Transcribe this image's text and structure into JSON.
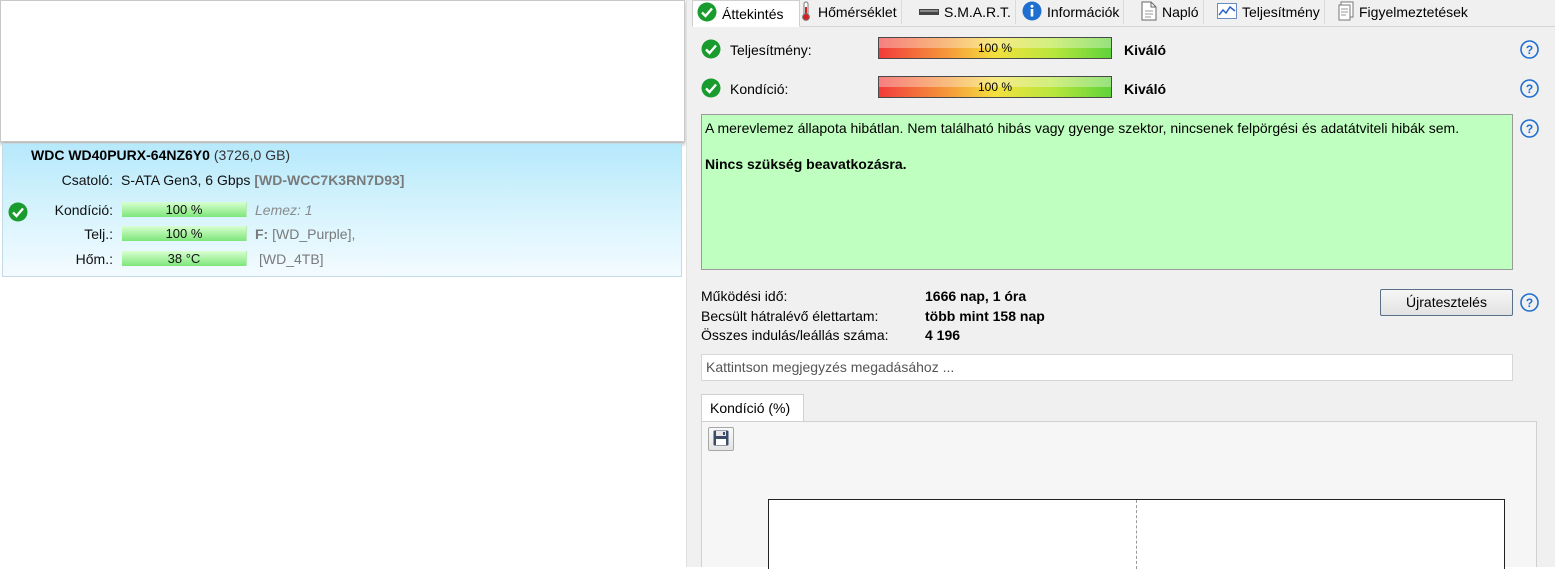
{
  "disk": {
    "title_model": "WDC WD40PURX-64NZ6Y0",
    "title_size": "(3726,0 GB)",
    "interface_label": "Csatoló:",
    "interface_value": "S-ATA Gen3, 6 Gbps",
    "serial": "[WD-WCC7K3RN7D93]",
    "condition_label": "Kondíció:",
    "condition_value": "100 %",
    "condition_level": 1.0,
    "perf_label": "Telj.:",
    "perf_value": "100 %",
    "perf_level": 1.0,
    "temp_label": "Hőm.:",
    "temp_value": "38 °C",
    "disk_number": "Lemez: 1",
    "drive_letter": "F:",
    "volume_name": "[WD_Purple],",
    "volume_name2": "[WD_4TB]"
  },
  "tabs": [
    {
      "label": "Áttekintés",
      "icon": "check-icon",
      "active": true
    },
    {
      "label": "Hőmérséklet",
      "icon": "thermometer-icon"
    },
    {
      "label": "S.M.A.R.T.",
      "icon": "smart-icon"
    },
    {
      "label": "Információk",
      "icon": "info-icon"
    },
    {
      "label": "Napló",
      "icon": "document-icon"
    },
    {
      "label": "Teljesítmény",
      "icon": "performance-chart-icon"
    },
    {
      "label": "Figyelmeztetések",
      "icon": "warnings-icon"
    }
  ],
  "overview": {
    "performance_label": "Teljesítmény:",
    "performance_bar": "100 %",
    "performance_level": 1.0,
    "performance_rating": "Kiváló",
    "condition_label": "Kondíció:",
    "condition_bar": "100 %",
    "condition_level": 1.0,
    "condition_rating": "Kiváló",
    "status_text": "A merevlemez állapota hibátlan. Nem található hibás vagy gyenge szektor, nincsenek felpörgési és adatátviteli hibák sem.",
    "status_action": "Nincs szükség beavatkozásra.",
    "status_color": "#bfffbf"
  },
  "stats": {
    "uptime_label": "Működési idő:",
    "uptime_value": "1666 nap, 1 óra",
    "remaining_label": "Becsült hátralévő élettartam:",
    "remaining_value": "több mint 158 nap",
    "startstop_label": "Összes indulás/leállás száma:",
    "startstop_value": "4 196"
  },
  "retest_button": "Újratesztelés",
  "note_placeholder": "Kattintson megjegyzés megadásához ...",
  "chart_tab_label": "Kondíció  (%)",
  "colors": {
    "ok_green": "#1a9b2e",
    "help_blue": "#1f6fd1",
    "accent_blue_gradient": "#b6e9fb"
  }
}
